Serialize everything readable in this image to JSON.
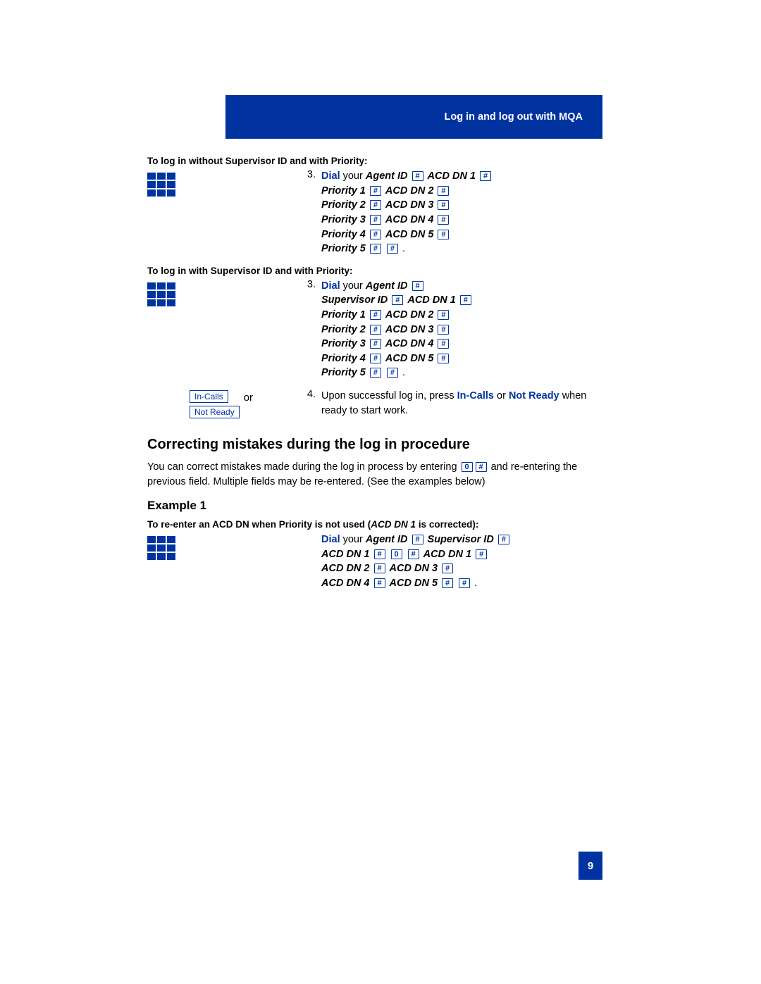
{
  "header": "Log in and log out with MQA",
  "section1": {
    "label": "To log in without Supervisor ID and with Priority:",
    "num": "3.",
    "lead": "Dial",
    "after_lead": " your ",
    "agent": "Agent ID",
    "acd1": "ACD DN 1",
    "p1": "Priority 1",
    "acd2": "ACD DN 2",
    "p2": "Priority 2",
    "acd3": "ACD DN 3",
    "p3": "Priority 3",
    "acd4": "ACD DN 4",
    "p4": "Priority 4",
    "acd5": "ACD DN 5",
    "p5": "Priority 5"
  },
  "section2": {
    "label": "To log in with Supervisor ID and with Priority:",
    "num": "3.",
    "lead": "Dial",
    "after_lead": " your ",
    "agent": "Agent ID",
    "sup": "Supervisor ID",
    "acd1": "ACD DN 1",
    "p1": "Priority 1",
    "acd2": "ACD DN 2",
    "p2": "Priority 2",
    "acd3": "ACD DN 3",
    "p3": "Priority 3",
    "acd4": "ACD DN 4",
    "p4": "Priority 4",
    "acd5": "ACD DN 5",
    "p5": "Priority 5"
  },
  "step4": {
    "softkey1": "In-Calls",
    "softkey2": "Not Ready",
    "or": "or",
    "num": "4.",
    "pre": "Upon successful log in, press ",
    "k1": "In-Calls",
    "mid": " or ",
    "k2": "Not Ready",
    "post": " when ready to start work."
  },
  "correct": {
    "title": "Correcting mistakes during the log in procedure",
    "body_pre": "You can correct mistakes made during the log in process by entering ",
    "body_post": " and re-entering the previous field.  Multiple fields may be re-entered.  (See the examples below)"
  },
  "example1": {
    "title": "Example 1",
    "label": "To re-enter an ACD DN when Priority is not used (",
    "label_em": "ACD DN 1",
    "label_end": " is corrected):",
    "lead": "Dial",
    "after_lead": " your ",
    "agent": "Agent ID",
    "sup": "Supervisor ID",
    "acd1": "ACD DN 1",
    "acd2": "ACD DN 2",
    "acd3": "ACD DN 3",
    "acd4": "ACD DN 4",
    "acd5": "ACD DN 5"
  },
  "keys": {
    "hash": "#",
    "zero": "0"
  },
  "page_number": "9"
}
